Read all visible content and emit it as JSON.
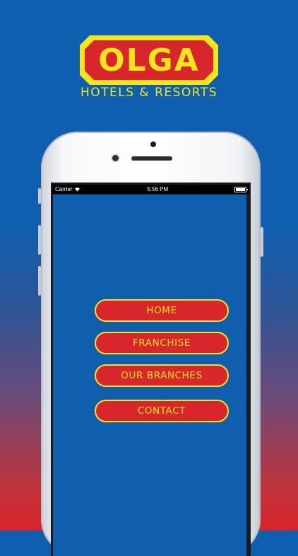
{
  "brand": {
    "logo_text": "OLGA",
    "tagline": "HOTELS & RESORTS",
    "logo_icon": "octagon-badge-logo"
  },
  "status_bar": {
    "carrier": "Carrier",
    "time": "5:56 PM",
    "wifi_icon": "wifi-icon",
    "battery_icon": "battery-icon"
  },
  "menu": {
    "home": "HOME",
    "franchise": "FRANCHISE",
    "branches": "OUR BRANCHES",
    "contact": "CONTACT"
  },
  "colors": {
    "accent": "#f5e61c",
    "button": "#d8262c",
    "screen_bg": "#0f5fae",
    "bg_top": "#0e5fb0",
    "bg_bottom": "#d8262c"
  }
}
